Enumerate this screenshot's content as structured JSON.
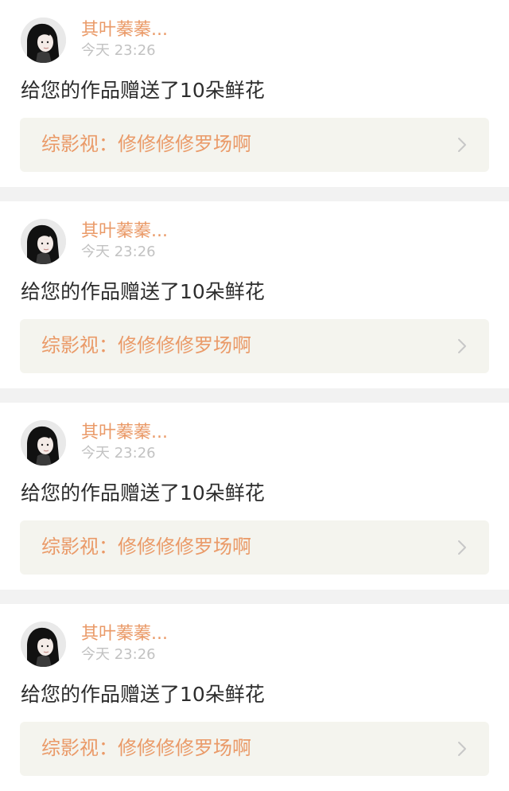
{
  "notifications": [
    {
      "user_name": "其叶蓁蓁...",
      "time": "今天 23:26",
      "message": "给您的作品赠送了10朵鲜花",
      "work_title": "综影视：修修修修罗场啊",
      "avatar_icon": "user-avatar-icon",
      "chevron_icon": "chevron-right-icon"
    },
    {
      "user_name": "其叶蓁蓁...",
      "time": "今天 23:26",
      "message": "给您的作品赠送了10朵鲜花",
      "work_title": "综影视：修修修修罗场啊",
      "avatar_icon": "user-avatar-icon",
      "chevron_icon": "chevron-right-icon"
    },
    {
      "user_name": "其叶蓁蓁...",
      "time": "今天 23:26",
      "message": "给您的作品赠送了10朵鲜花",
      "work_title": "综影视：修修修修罗场啊",
      "avatar_icon": "user-avatar-icon",
      "chevron_icon": "chevron-right-icon"
    },
    {
      "user_name": "其叶蓁蓁...",
      "time": "今天 23:26",
      "message": "给您的作品赠送了10朵鲜花",
      "work_title": "综影视：修修修修罗场啊",
      "avatar_icon": "user-avatar-icon",
      "chevron_icon": "chevron-right-icon"
    }
  ],
  "colors": {
    "accent": "#ea9a68",
    "secondary_text": "#c2c2c2",
    "primary_text": "#2d2d2d",
    "card_background": "#ffffff",
    "separator": "#f2f2f2",
    "link_background": "#f4f4ee"
  }
}
